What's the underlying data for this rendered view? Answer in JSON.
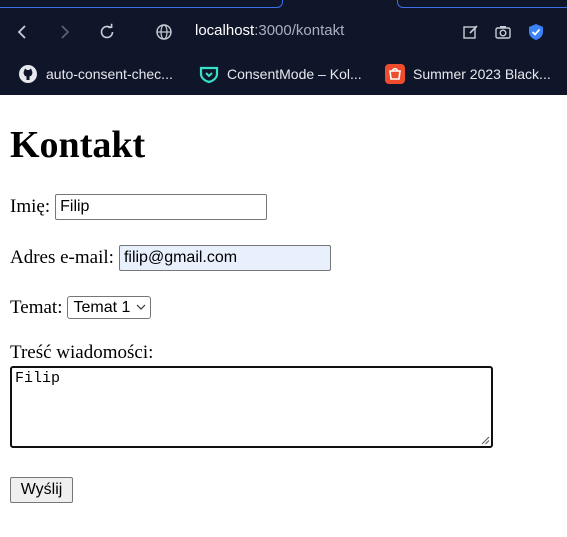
{
  "browser": {
    "url_host": "localhost",
    "url_path": ":3000/kontakt",
    "bookmarks": [
      {
        "label": "auto-consent-chec...",
        "icon": "github-icon"
      },
      {
        "label": "ConsentMode – Kol...",
        "icon": "shield-logo-icon"
      },
      {
        "label": "Summer 2023 Black...",
        "icon": "shop-bag-icon"
      }
    ]
  },
  "page": {
    "title": "Kontakt",
    "form": {
      "name_label": "Imię:",
      "name_value": "Filip",
      "email_label": "Adres e-mail:",
      "email_value": "filip@gmail.com",
      "topic_label": "Temat:",
      "topic_selected": "Temat 1",
      "message_label": "Treść wiadomości:",
      "message_value": "Filip",
      "submit_label": "Wyślij"
    }
  },
  "colors": {
    "chrome_bg": "#0f1629",
    "tab_outline": "#3b6ee8",
    "autofill_bg": "#e8f0fe",
    "shield_blue": "#3b82f6"
  }
}
